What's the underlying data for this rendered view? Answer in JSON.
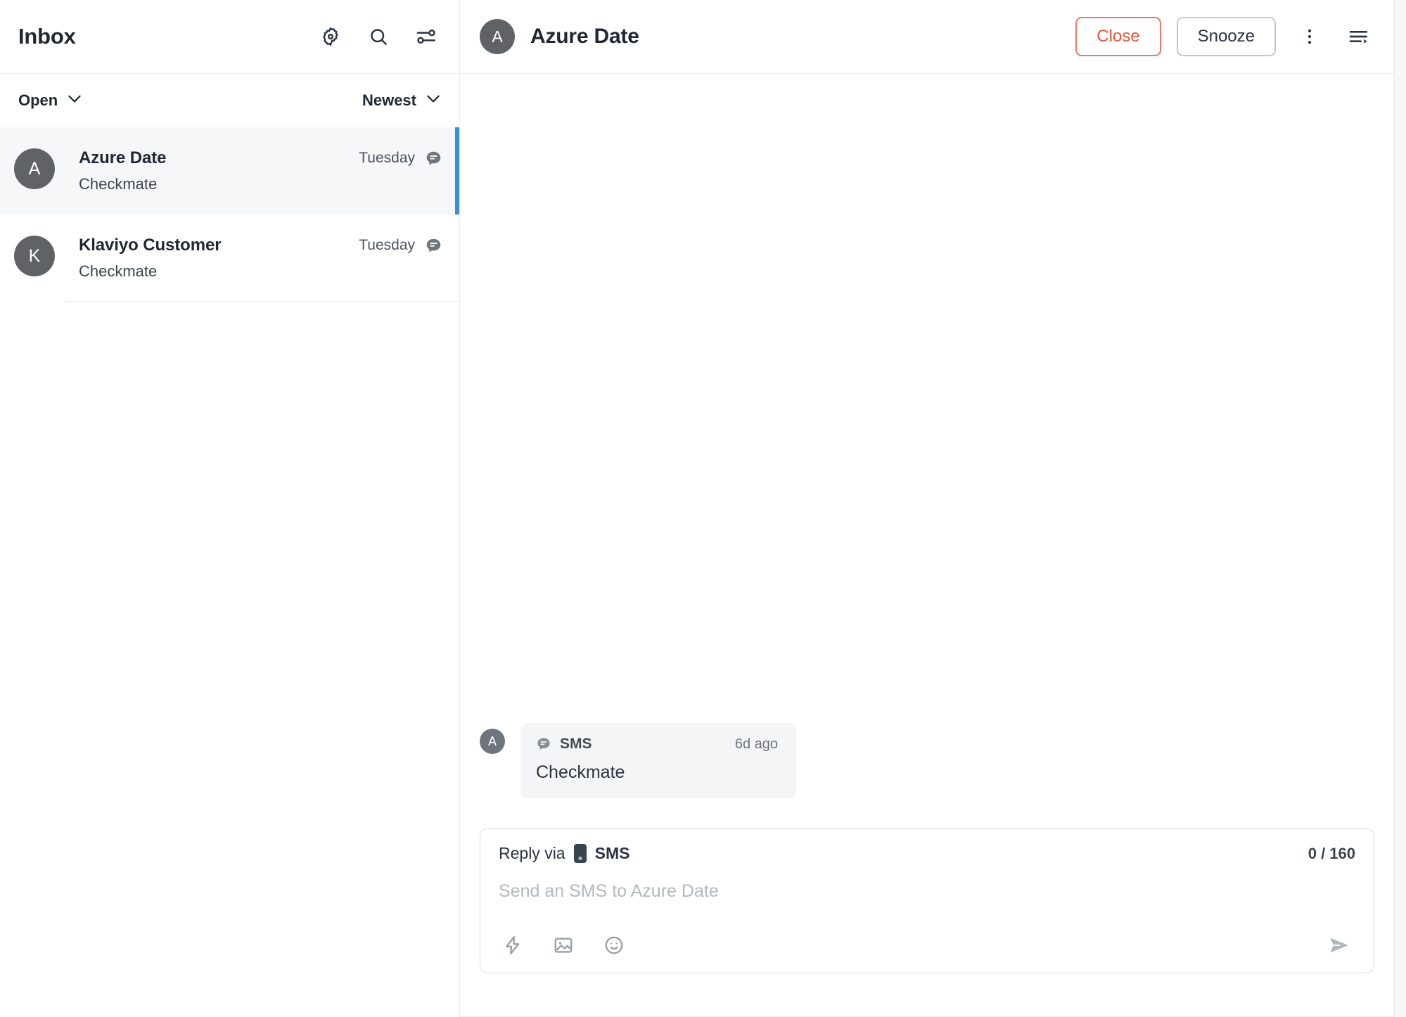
{
  "sidebar": {
    "title": "Inbox",
    "header_icons": [
      {
        "name": "settings-gear-icon",
        "label": "Settings"
      },
      {
        "name": "search-icon",
        "label": "Search"
      },
      {
        "name": "filter-sliders-icon",
        "label": "Filters"
      }
    ],
    "filters": {
      "status": "Open",
      "sort": "Newest"
    },
    "conversations": [
      {
        "initial": "A",
        "name": "Azure Date",
        "time": "Tuesday",
        "preview": "Checkmate",
        "channel_icon": "sms-chat-icon",
        "selected": true
      },
      {
        "initial": "K",
        "name": "Klaviyo Customer",
        "time": "Tuesday",
        "preview": "Checkmate",
        "channel_icon": "sms-chat-icon",
        "selected": false
      }
    ]
  },
  "conversation": {
    "avatar_initial": "A",
    "title": "Azure Date",
    "actions": {
      "close_label": "Close",
      "snooze_label": "Snooze",
      "more_icon": "more-vertical-icon",
      "details_icon": "conversation-details-icon"
    },
    "messages": [
      {
        "avatar_initial": "A",
        "channel": "SMS",
        "channel_icon": "sms-chat-icon",
        "time": "6d ago",
        "text": "Checkmate"
      }
    ],
    "composer": {
      "reply_via_label": "Reply via",
      "channel_label": "SMS",
      "channel_icon": "mobile-phone-icon",
      "char_count": "0 / 160",
      "placeholder": "Send an SMS to Azure Date",
      "tools": [
        {
          "name": "quick-reply-lightning-icon"
        },
        {
          "name": "attach-image-icon"
        },
        {
          "name": "emoji-picker-icon"
        }
      ],
      "send_icon": "send-paper-plane-icon"
    }
  },
  "colors": {
    "selection_accent": "#3b8fd4",
    "close_border": "#e8796b",
    "close_text": "#e4553f",
    "avatar_bg": "#5f6368",
    "bubble_bg": "#f3f5f7",
    "selected_row_bg": "#f5f7f9"
  }
}
